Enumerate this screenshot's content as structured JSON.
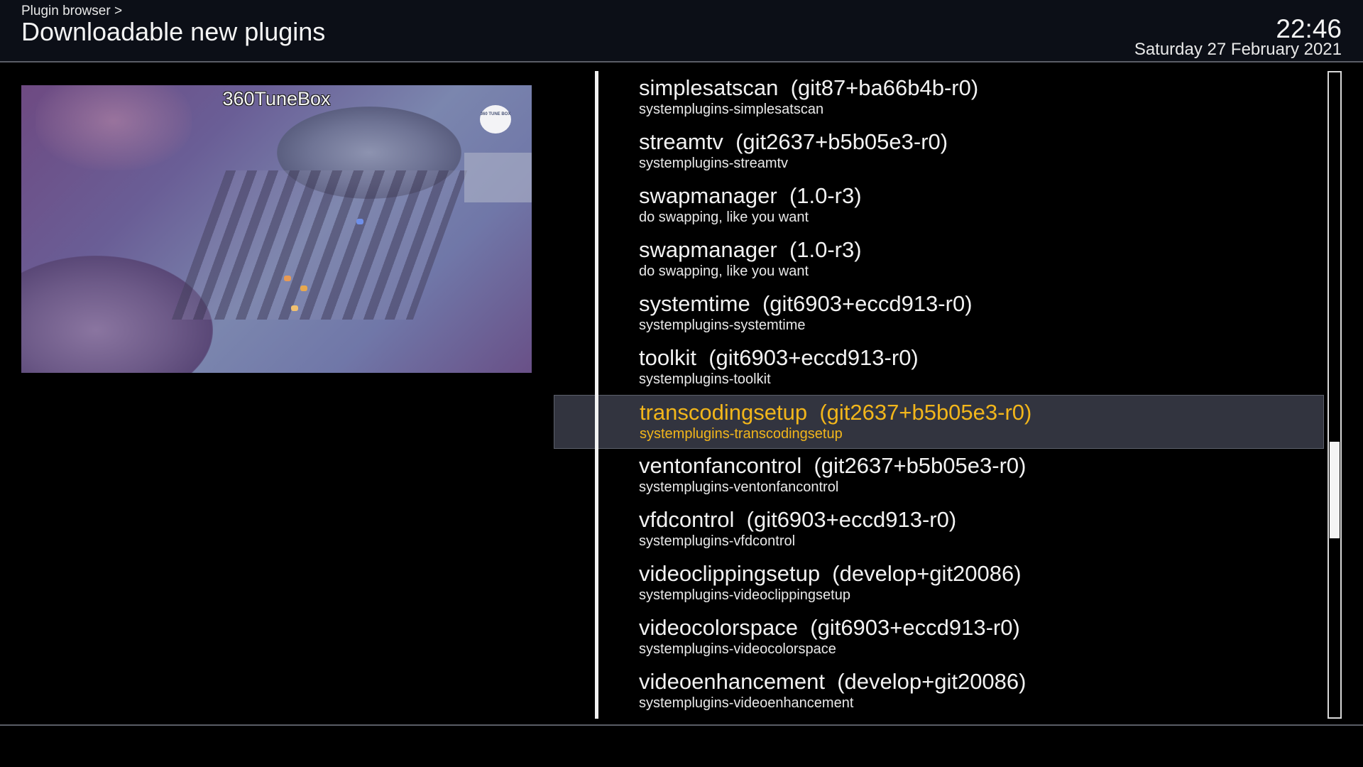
{
  "header": {
    "breadcrumb": "Plugin browser >",
    "title": "Downloadable new plugins",
    "time": "22:46",
    "date": "Saturday 27 February 2021"
  },
  "preview": {
    "channel_name": "360TuneBox",
    "logo_text": "360 TUNE BOX"
  },
  "plugins": [
    {
      "name": "simplesatscan  (git87+ba66b4b-r0)",
      "description": "systemplugins-simplesatscan"
    },
    {
      "name": "streamtv  (git2637+b5b05e3-r0)",
      "description": "systemplugins-streamtv"
    },
    {
      "name": "swapmanager  (1.0-r3)",
      "description": "do swapping, like you want"
    },
    {
      "name": "swapmanager  (1.0-r3)",
      "description": "do swapping, like you want"
    },
    {
      "name": "systemtime  (git6903+eccd913-r0)",
      "description": "systemplugins-systemtime"
    },
    {
      "name": "toolkit  (git6903+eccd913-r0)",
      "description": "systemplugins-toolkit"
    },
    {
      "name": "transcodingsetup  (git2637+b5b05e3-r0)",
      "description": "systemplugins-transcodingsetup",
      "selected": true
    },
    {
      "name": "ventonfancontrol  (git2637+b5b05e3-r0)",
      "description": "systemplugins-ventonfancontrol"
    },
    {
      "name": "vfdcontrol  (git6903+eccd913-r0)",
      "description": "systemplugins-vfdcontrol"
    },
    {
      "name": "videoclippingsetup  (develop+git20086)",
      "description": "systemplugins-videoclippingsetup"
    },
    {
      "name": "videocolorspace  (git6903+eccd913-r0)",
      "description": "systemplugins-videocolorspace"
    },
    {
      "name": "videoenhancement  (develop+git20086)",
      "description": "systemplugins-videoenhancement"
    }
  ],
  "colors": {
    "selected_text": "#f2b61b",
    "selected_background": "#32343f",
    "header_background": "#0c0f17"
  },
  "icons": {
    "channel_logo": "channel-logo-icon"
  }
}
